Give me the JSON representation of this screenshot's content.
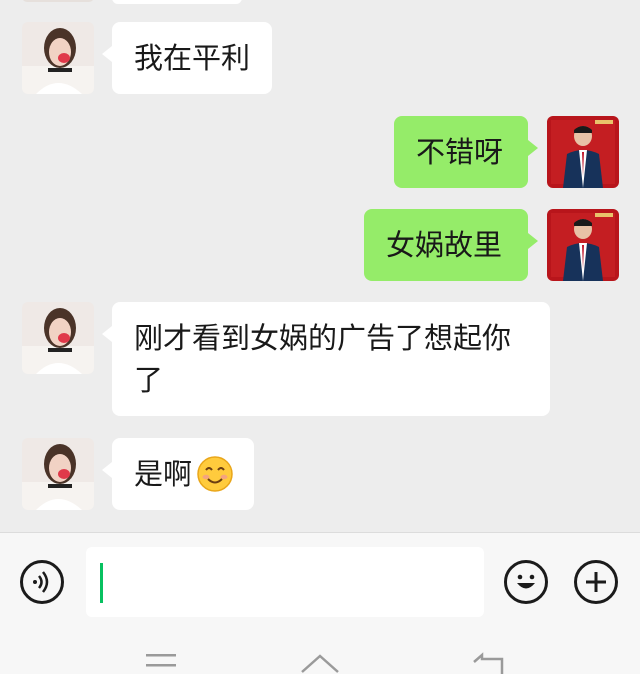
{
  "messages": [
    {
      "side": "left",
      "sender": "contact",
      "text": "我在平利"
    },
    {
      "side": "right",
      "sender": "self",
      "text": "不错呀"
    },
    {
      "side": "right",
      "sender": "self",
      "text": "女娲故里"
    },
    {
      "side": "left",
      "sender": "contact",
      "text": "刚才看到女娲的广告了想起你了"
    },
    {
      "side": "left",
      "sender": "contact",
      "text": "是啊",
      "emoji": "smile-emoji"
    }
  ],
  "input": {
    "value": ""
  },
  "icons": {
    "voice": "voice-icon",
    "emoji": "emoji-icon",
    "more": "plus-icon",
    "nav_menu": "menu-icon",
    "nav_home": "home-icon",
    "nav_back": "back-icon"
  },
  "colors": {
    "self_bubble": "#95ec69",
    "contact_bubble": "#ffffff",
    "background": "#ededed",
    "cursor": "#07c160"
  }
}
